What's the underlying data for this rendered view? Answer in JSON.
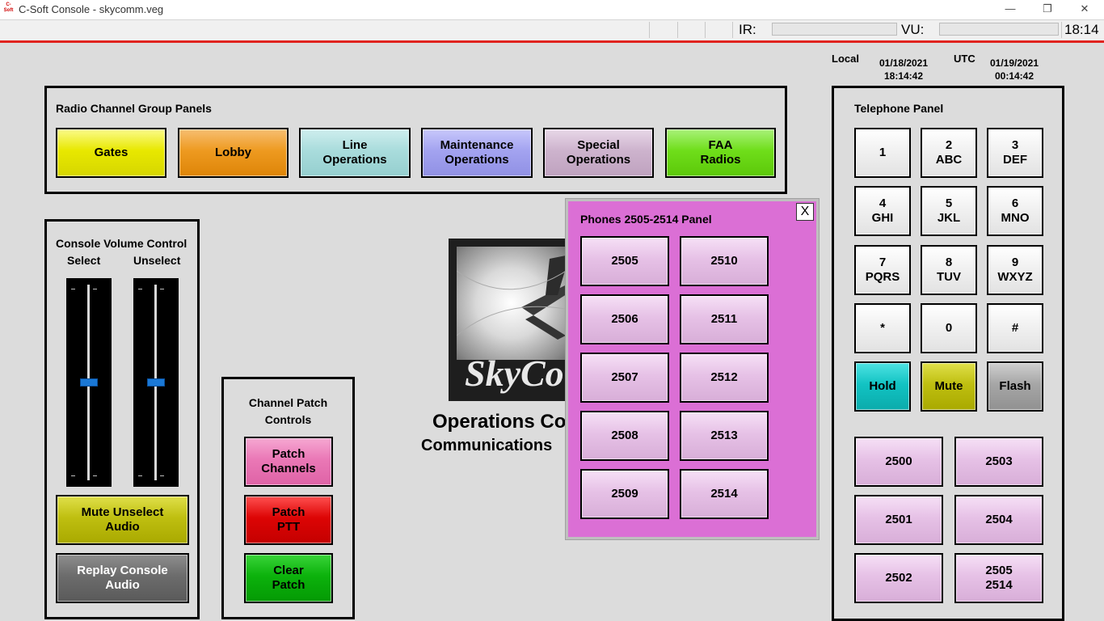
{
  "window": {
    "title": "C-Soft Console - skycomm.veg",
    "app_icon_text": "C-Soft",
    "minimize": "—",
    "restore": "❐",
    "close": "✕"
  },
  "statusbar": {
    "ir_label": "IR:",
    "vu_label": "VU:",
    "time": "18:14"
  },
  "clock": {
    "local_label": "Local",
    "local_date": "01/18/2021",
    "local_time": "18:14:42",
    "utc_label": "UTC",
    "utc_date": "01/19/2021",
    "utc_time": "00:14:42"
  },
  "radio_panel": {
    "title": "Radio Channel Group Panels",
    "buttons": [
      "Gates",
      "Lobby",
      "Line\nOperations",
      "Maintenance\nOperations",
      "Special\nOperations",
      "FAA\nRadios"
    ]
  },
  "volume_panel": {
    "title": "Console Volume Control",
    "select_label": "Select",
    "unselect_label": "Unselect",
    "select_level": 0.5,
    "unselect_level": 0.5,
    "mute_button": "Mute Unselect\nAudio",
    "replay_button": "Replay Console\nAudio"
  },
  "patch_panel": {
    "title": "Channel Patch\nControls",
    "patch_channels": "Patch\nChannels",
    "patch_ptt": "Patch\nPTT",
    "clear_patch": "Clear\nPatch"
  },
  "logo": {
    "text": "SkyCo"
  },
  "center": {
    "title": "Operations Co",
    "subtitle": "Communications"
  },
  "popup": {
    "title": "Phones 2505-2514 Panel",
    "close": "X",
    "buttons": [
      "2505",
      "2510",
      "2506",
      "2511",
      "2507",
      "2512",
      "2508",
      "2513",
      "2509",
      "2514"
    ]
  },
  "telephone": {
    "title": "Telephone Panel",
    "keys": [
      "1",
      "2\nABC",
      "3\nDEF",
      "4\nGHI",
      "5\nJKL",
      "6\nMNO",
      "7\nPQRS",
      "8\nTUV",
      "9\nWXYZ",
      "*",
      "0",
      "#"
    ],
    "hold": "Hold",
    "mute": "Mute",
    "flash": "Flash",
    "lines": [
      "2500",
      "2503",
      "2501",
      "2504",
      "2502",
      "2505\n2514"
    ]
  }
}
